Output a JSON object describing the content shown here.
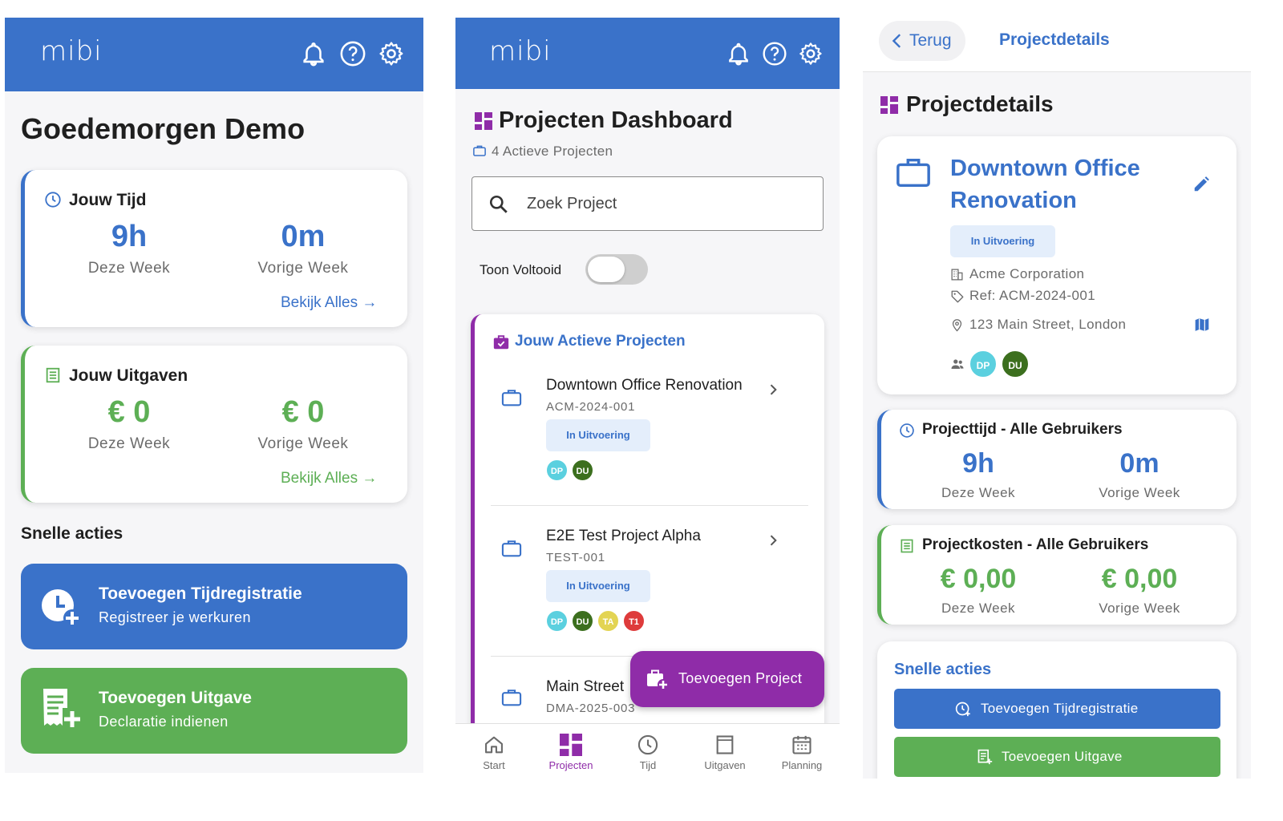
{
  "app": {
    "logo": "mibi"
  },
  "colors": {
    "primary": "#3a72c9",
    "success": "#5daf55",
    "accent_purple": "#8f2ca8",
    "pink": "#e84393"
  },
  "home": {
    "greeting": "Goedemorgen Demo",
    "time_card": {
      "title": "Jouw Tijd",
      "this_week_value": "9h",
      "this_week_label": "Deze Week",
      "last_week_value": "0m",
      "last_week_label": "Vorige Week",
      "link": "Bekijk Alles →"
    },
    "expense_card": {
      "title": "Jouw Uitgaven",
      "this_week_value": "€ 0",
      "this_week_label": "Deze Week",
      "last_week_value": "€ 0",
      "last_week_label": "Vorige Week",
      "link": "Bekijk Alles →"
    },
    "quick_actions_title": "Snelle acties",
    "action_time": {
      "title": "Toevoegen Tijdregistratie",
      "subtitle": "Registreer je werkuren"
    },
    "action_expense": {
      "title": "Toevoegen Uitgave",
      "subtitle": "Declaratie indienen"
    }
  },
  "projects": {
    "title": "Projecten Dashboard",
    "active_count": "4 Actieve Projecten",
    "search_placeholder": "Zoek Project",
    "toggle_label": "Toon Voltooid",
    "toggle_on": false,
    "section_title": "Jouw Actieve Projecten",
    "items": [
      {
        "name": "Downtown Office Renovation",
        "ref": "ACM-2024-001",
        "status": "In Uitvoering",
        "avatars": [
          "DP",
          "DU"
        ]
      },
      {
        "name": "E2E Test Project Alpha",
        "ref": "TEST-001",
        "status": "In Uitvoering",
        "avatars": [
          "DP",
          "DU",
          "TA",
          "T1"
        ]
      },
      {
        "name": "Main Street",
        "ref": "DMA-2025-003"
      }
    ],
    "fab_label": "Toevoegen Project",
    "nav": [
      {
        "label": "Start",
        "icon": "home-icon",
        "active": false
      },
      {
        "label": "Projecten",
        "icon": "dashboard-icon",
        "active": true
      },
      {
        "label": "Tijd",
        "icon": "clock-icon",
        "active": false
      },
      {
        "label": "Uitgaven",
        "icon": "receipt-icon",
        "active": false
      },
      {
        "label": "Planning",
        "icon": "calendar-icon",
        "active": false
      }
    ]
  },
  "details": {
    "back_label": "Terug",
    "header_title": "Projectdetails",
    "page_title": "Projectdetails",
    "project_name_line1": "Downtown Office",
    "project_name_line2": "Renovation",
    "status": "In Uitvoering",
    "client": "Acme Corporation",
    "ref": "Ref: ACM-2024-001",
    "address": "123 Main Street, London",
    "avatars": [
      "DP",
      "DU"
    ],
    "time_card": {
      "title": "Projecttijd - Alle Gebruikers",
      "this_week_value": "9h",
      "this_week_label": "Deze Week",
      "last_week_value": "0m",
      "last_week_label": "Vorige Week"
    },
    "cost_card": {
      "title": "Projectkosten - Alle Gebruikers",
      "this_week_value": "€ 0,00",
      "this_week_label": "Deze Week",
      "last_week_value": "€ 0,00",
      "last_week_label": "Vorige Week"
    },
    "quick_actions_title": "Snelle acties",
    "btn_time": "Toevoegen Tijdregistratie",
    "btn_expense": "Toevoegen Uitgave"
  }
}
